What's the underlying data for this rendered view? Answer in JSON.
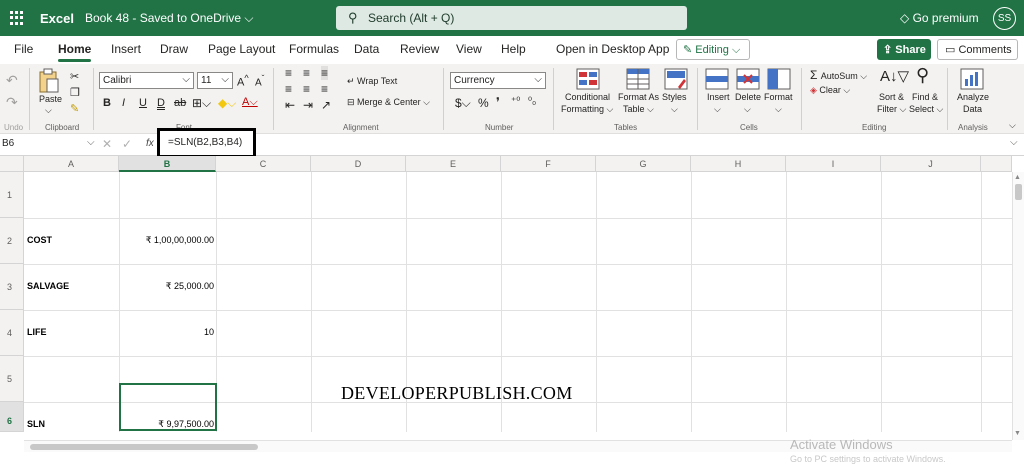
{
  "titlebar": {
    "app_name": "Excel",
    "document": "Book 48  -  Saved to OneDrive ⌵",
    "search_placeholder": "Search (Alt + Q)",
    "premium": "Go premium",
    "user_initials": "SS"
  },
  "tabs": [
    {
      "label": "File"
    },
    {
      "label": "Home"
    },
    {
      "label": "Insert"
    },
    {
      "label": "Draw"
    },
    {
      "label": "Page Layout"
    },
    {
      "label": "Formulas"
    },
    {
      "label": "Data"
    },
    {
      "label": "Review"
    },
    {
      "label": "View"
    },
    {
      "label": "Help"
    },
    {
      "label": "Open in Desktop App"
    }
  ],
  "actions": {
    "editing": "Editing ⌵",
    "share": "Share",
    "comments": "Comments"
  },
  "ribbon": {
    "undo_label": "Undo",
    "clipboard": {
      "paste": "Paste",
      "group": "Clipboard"
    },
    "font": {
      "name": "Calibri",
      "size": "11",
      "group": "Font"
    },
    "alignment": {
      "wrap_text": "Wrap Text",
      "merge_center": "Merge & Center",
      "group": "Alignment"
    },
    "number": {
      "format": "Currency",
      "group": "Number"
    },
    "tables": {
      "conditional": "Conditional",
      "formatting": "Formatting ⌵",
      "format_as": "Format As",
      "table": "Table ⌵",
      "styles": "Styles",
      "group": "Tables"
    },
    "cells": {
      "insert": "Insert",
      "delete": "Delete",
      "format": "Format",
      "group": "Cells"
    },
    "editing": {
      "autosum": "AutoSum ⌵",
      "clear": "Clear ⌵",
      "sort": "Sort &",
      "filter": "Filter ⌵",
      "find": "Find &",
      "select": "Select ⌵",
      "group": "Editing"
    },
    "analysis": {
      "analyze": "Analyze",
      "data": "Data",
      "group": "Analysis"
    }
  },
  "formula_bar": {
    "name_box": "B6",
    "fx": "fx",
    "formula": "=SLN(B2,B3,B4)"
  },
  "sheet": {
    "columns": [
      "A",
      "B",
      "C",
      "D",
      "E",
      "F",
      "G",
      "H",
      "I",
      "J"
    ],
    "rows": [
      "1",
      "2",
      "3",
      "4",
      "5",
      "6"
    ],
    "cells": {
      "A2": "COST",
      "B2": "₹ 1,00,00,000.00",
      "A3": "SALVAGE",
      "B3": "₹ 25,000.00",
      "A4": "LIFE",
      "B4": "10",
      "A6": "SLN",
      "B6": "₹ 9,97,500.00"
    },
    "selected_cell": "B6"
  },
  "overlay": {
    "watermark": "DEVELOPERPUBLISH.COM",
    "activate_title": "Activate Windows",
    "activate_sub": "Go to PC settings to activate Windows."
  },
  "colors": {
    "accent": "#217346",
    "ribbon_bg": "#f3f2f1"
  }
}
